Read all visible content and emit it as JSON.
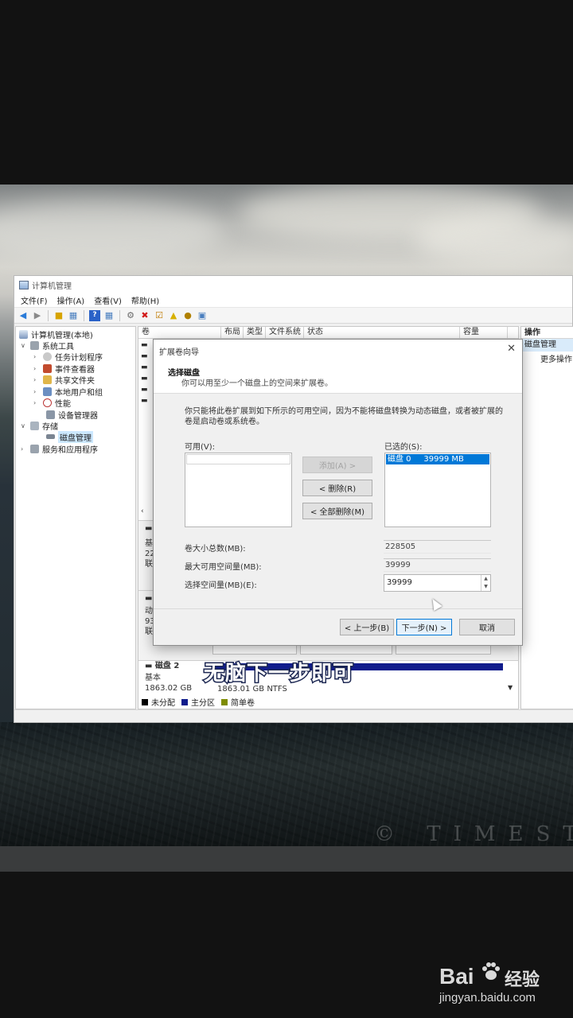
{
  "window": {
    "title": "计算机管理",
    "menu": [
      "文件(F)",
      "操作(A)",
      "查看(V)",
      "帮助(H)"
    ]
  },
  "tree": {
    "root": "计算机管理(本地)",
    "system_tools": "系统工具",
    "task_scheduler": "任务计划程序",
    "event_viewer": "事件查看器",
    "shared_folders": "共享文件夹",
    "local_users": "本地用户和组",
    "performance": "性能",
    "device_manager": "设备管理器",
    "storage": "存储",
    "disk_management": "磁盘管理",
    "services": "服务和应用程序"
  },
  "columns": {
    "volume": "卷",
    "layout": "布局",
    "type": "类型",
    "filesystem": "文件系统",
    "status": "状态",
    "capacity": "容量"
  },
  "disks": {
    "disk1_type": "基本",
    "disk1_size": "22",
    "disk1_state": "联",
    "disk_b_type": "动",
    "disk_b_size": "93",
    "disk_b_state": "联",
    "disk2_name": "磁盘 2",
    "disk2_type": "基本",
    "disk2_size": "1863.02 GB",
    "disk2_partition": "1863.01 GB NTFS"
  },
  "legend": {
    "unallocated": "未分配",
    "primary": "主分区",
    "simple": "简单卷",
    "colors": {
      "unallocated": "#000000",
      "primary": "#101c8c",
      "simple": "#7f8c00"
    }
  },
  "actions": {
    "header": "操作",
    "selected": "磁盘管理",
    "more": "更多操作"
  },
  "dialog": {
    "title": "扩展卷向导",
    "heading": "选择磁盘",
    "subheading": "你可以用至少一个磁盘上的空间来扩展卷。",
    "description": "你只能将此卷扩展到如下所示的可用空间，因为不能将磁盘转换为动态磁盘，或者被扩展的卷是启动卷或系统卷。",
    "available_label": "可用(V):",
    "selected_label": "已选的(S):",
    "selected_item": "磁盘 0     39999 MB",
    "add_button": "添加(A) >",
    "remove_button": "< 删除(R)",
    "remove_all_button": "< 全部删除(M)",
    "total_label": "卷大小总数(MB):",
    "total_value": "228505",
    "max_label": "最大可用空间量(MB):",
    "max_value": "39999",
    "select_label": "选择空间量(MB)(E):",
    "select_value": "39999",
    "back_button": "< 上一步(B)",
    "next_button": "下一步(N) >",
    "cancel_button": "取消"
  },
  "subtitle": "无脑下一步即可",
  "watermark": {
    "time_text": "© TIMESTO",
    "baidu_brand": "Bai",
    "baidu_jy": "经验",
    "baidu_url": "jingyan.baidu.com"
  }
}
